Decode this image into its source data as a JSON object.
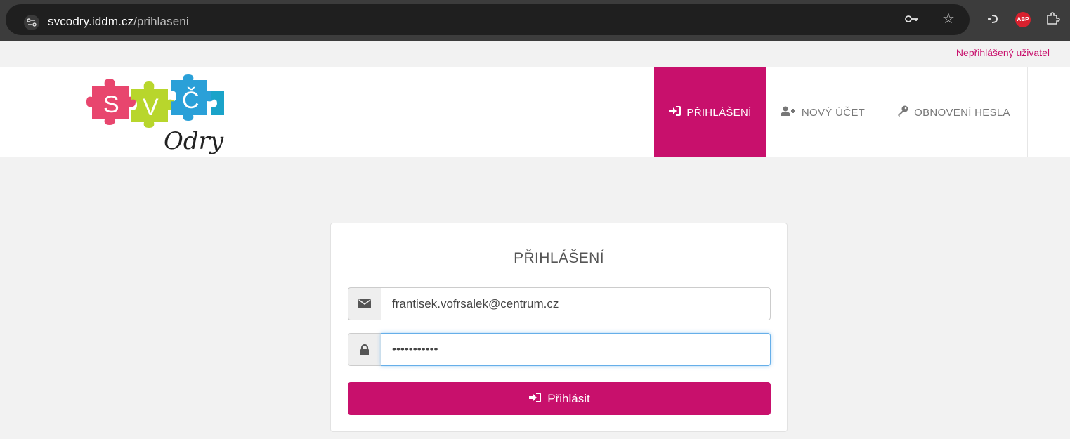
{
  "browser": {
    "url_host": "svcodry.iddm.cz",
    "url_path": "/prihlaseni",
    "icons": [
      "site-settings-icon",
      "key-icon",
      "star-icon",
      "extension-icon",
      "adblock-icon",
      "puzzle-icon"
    ],
    "abp_label": "ABP"
  },
  "topbar": {
    "user_status": "Nepřihlášený uživatel"
  },
  "logo": {
    "letters": [
      "S",
      "V",
      "Č"
    ],
    "script": "Odry",
    "colors": [
      "#e8466e",
      "#b8d62c",
      "#2aa0d8",
      "#1aa3c9"
    ]
  },
  "nav": {
    "items": [
      {
        "label": "PŘIHLÁŠENÍ",
        "icon": "sign-in-icon",
        "active": true
      },
      {
        "label": "NOVÝ ÚČET",
        "icon": "user-plus-icon",
        "active": false
      },
      {
        "label": "OBNOVENÍ HESLA",
        "icon": "key-icon",
        "active": false
      }
    ]
  },
  "login": {
    "title": "PŘIHLÁŠENÍ",
    "email_value": "frantisek.vofrsalek@centrum.cz",
    "password_value": "•••••••••••",
    "submit_label": "Přihlásit",
    "email_icon": "envelope-icon",
    "password_icon": "lock-icon"
  },
  "colors": {
    "accent": "#c8106c",
    "focus": "#66afe9"
  }
}
